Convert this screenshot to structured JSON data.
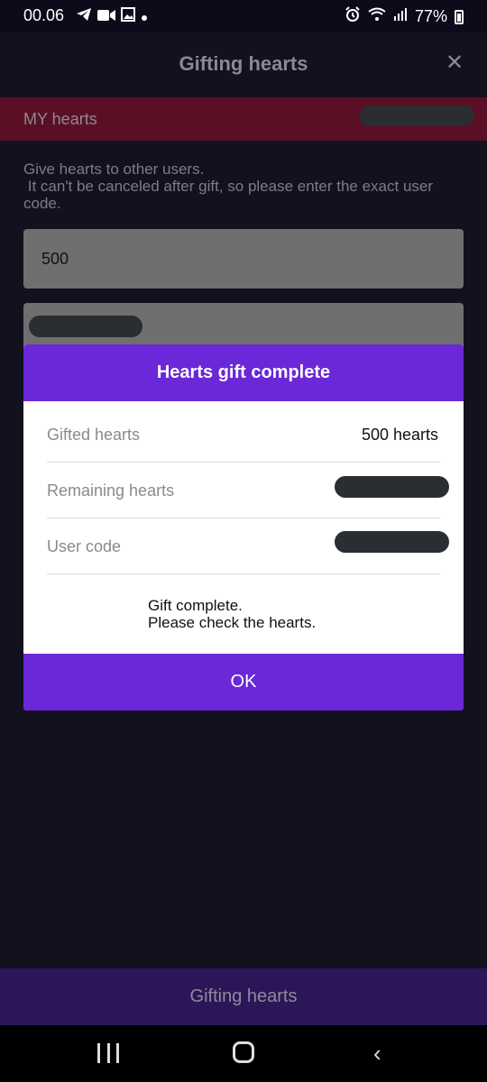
{
  "status": {
    "time": "00.06",
    "battery": "77%",
    "icons_left": [
      "telegram-icon",
      "video-icon",
      "image-icon",
      "dot-icon"
    ],
    "icons_right": [
      "alarm-icon",
      "wifi-icon",
      "signal-icon",
      "battery-icon"
    ]
  },
  "header": {
    "title": "Gifting hearts",
    "close_icon": "close-icon"
  },
  "my_hearts": {
    "label": "MY hearts"
  },
  "instruction": "Give hearts to other users.\n It can't be canceled after gift, so please enter the exact user code.",
  "form": {
    "amount_value": "500"
  },
  "modal": {
    "title": "Hearts gift complete",
    "rows": [
      {
        "label": "Gifted hearts",
        "value": "500 hearts"
      },
      {
        "label": "Remaining hearts"
      },
      {
        "label": "User code"
      }
    ],
    "message": "Gift complete.\nPlease check the hearts.",
    "ok_label": "OK"
  },
  "bottom_button": {
    "label": "Gifting hearts"
  },
  "colors": {
    "accent": "#6a28d8",
    "my_hearts_bar": "#5a0f25",
    "bottom_button": "#2c1657"
  }
}
